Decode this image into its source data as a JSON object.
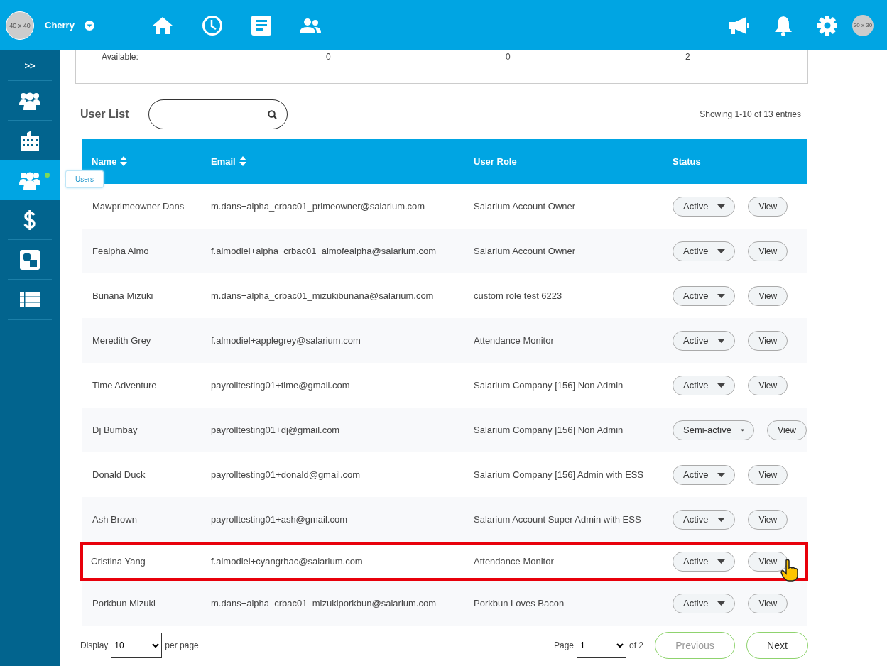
{
  "topbar": {
    "user_avatar": "40 x 40",
    "user_name": "Cherry",
    "nav_icons": [
      {
        "kind": "home"
      },
      {
        "kind": "clock"
      },
      {
        "kind": "document"
      },
      {
        "kind": "people"
      }
    ],
    "action_icons": [
      {
        "kind": "megaphone"
      },
      {
        "kind": "bell"
      },
      {
        "kind": "settings"
      }
    ],
    "small_avatar": "30 x 30"
  },
  "sidebar": {
    "toggle": ">>",
    "items": [
      {
        "kind": "group",
        "selected": false
      },
      {
        "kind": "building",
        "selected": false
      },
      {
        "kind": "group",
        "selected": true,
        "tooltip": "Users",
        "notify_dot": true
      },
      {
        "kind": "dollar",
        "selected": false
      },
      {
        "kind": "shapes",
        "selected": false
      },
      {
        "kind": "list",
        "selected": false
      }
    ]
  },
  "summary": {
    "label": "Available:",
    "values": [
      "0",
      "0",
      "2"
    ]
  },
  "user_list": {
    "title": "User List",
    "showing": "Showing 1-10 of 13 entries",
    "columns": [
      {
        "label": "Name",
        "sortable": true
      },
      {
        "label": "Email",
        "sortable": true
      },
      {
        "label": "User Role",
        "sortable": false
      },
      {
        "label": "Status",
        "sortable": false
      }
    ],
    "rows": [
      {
        "name": "Mawprimeowner Dans",
        "email": "m.dans+alpha_crbac01_primeowner@salarium.com",
        "role": "Salarium Account Owner",
        "status": "Active",
        "action": "View",
        "highlighted": false,
        "hovered": false
      },
      {
        "name": "Fealpha Almo",
        "email": "f.almodiel+alpha_crbac01_almofealpha@salarium.com",
        "role": "Salarium Account Owner",
        "status": "Active",
        "action": "View",
        "highlighted": false,
        "hovered": false
      },
      {
        "name": "Bunana Mizuki",
        "email": "m.dans+alpha_crbac01_mizukibunana@salarium.com",
        "role": "custom role test 6223",
        "status": "Active",
        "action": "View",
        "highlighted": false,
        "hovered": false
      },
      {
        "name": "Meredith Grey",
        "email": "f.almodiel+applegrey@salarium.com",
        "role": "Attendance Monitor",
        "status": "Active",
        "action": "View",
        "highlighted": false,
        "hovered": false
      },
      {
        "name": "Time Adventure",
        "email": "payrolltesting01+time@gmail.com",
        "role": "Salarium Company [156] Non Admin",
        "status": "Active",
        "action": "View",
        "highlighted": false,
        "hovered": false
      },
      {
        "name": "Dj Bumbay",
        "email": "payrolltesting01+dj@gmail.com",
        "role": "Salarium Company [156] Non Admin",
        "status": "Semi-active",
        "action": "View",
        "highlighted": false,
        "hovered": false
      },
      {
        "name": "Donald Duck",
        "email": "payrolltesting01+donald@gmail.com",
        "role": "Salarium Company [156] Admin with ESS",
        "status": "Active",
        "action": "View",
        "highlighted": false,
        "hovered": false
      },
      {
        "name": "Ash Brown",
        "email": "payrolltesting01+ash@gmail.com",
        "role": "Salarium Account Super Admin with ESS",
        "status": "Active",
        "action": "View",
        "highlighted": false,
        "hovered": false
      },
      {
        "name": "Cristina Yang",
        "email": "f.almodiel+cyangrbac@salarium.com",
        "role": "Attendance Monitor",
        "status": "Active",
        "action": "View",
        "highlighted": true,
        "hovered": true
      },
      {
        "name": "Porkbun Mizuki",
        "email": "m.dans+alpha_crbac01_mizukiporkbun@salarium.com",
        "role": "Porkbun Loves Bacon",
        "status": "Active",
        "action": "View",
        "highlighted": false,
        "hovered": false
      }
    ],
    "footer": {
      "display_label": "Display",
      "per_page": "10",
      "per_page_label": "per page",
      "page_label": "Page",
      "page": "1",
      "of_pages": "of 2",
      "previous": {
        "label": "Previous",
        "disabled": true
      },
      "next": {
        "label": "Next",
        "disabled": false
      }
    }
  }
}
